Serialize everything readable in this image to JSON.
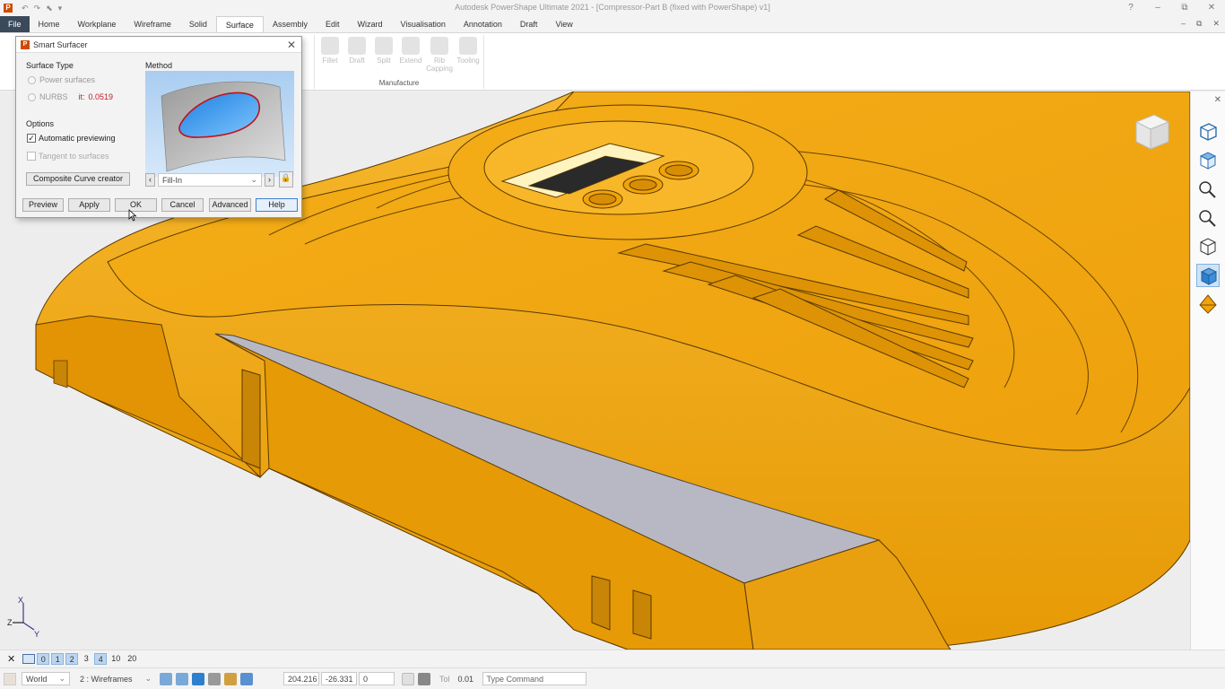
{
  "app": {
    "title": "Autodesk PowerShape Ultimate 2021 - [Compressor-Part B (fixed with PowerShape) v1]"
  },
  "window_controls": {
    "help": "?",
    "minimize": "–",
    "restore": "⧉",
    "close": "✕"
  },
  "tabs": [
    "File",
    "Home",
    "Workplane",
    "Wireframe",
    "Solid",
    "Surface",
    "Assembly",
    "Edit",
    "Wizard",
    "Visualisation",
    "Annotation",
    "Draft",
    "View"
  ],
  "active_tab": "Surface",
  "ribbon": {
    "manufacture_group": {
      "label": "Manufacture",
      "buttons": [
        "Fillet",
        "Draft",
        "Split",
        "Extend",
        "Rib Capping",
        "Tooling"
      ]
    }
  },
  "dialog": {
    "title": "Smart Surfacer",
    "surface_type": {
      "label": "Surface Type",
      "option_power": "Power surfaces",
      "option_nurbs": "NURBS",
      "tolerance_label": "it:",
      "tolerance_value": "0.0519"
    },
    "options": {
      "label": "Options",
      "automatic_previewing": "Automatic previewing",
      "automatic_previewing_checked": true,
      "tangent_to_surfaces": "Tangent to surfaces",
      "tangent_to_surfaces_checked": false
    },
    "composite_button": "Composite Curve creator",
    "method": {
      "label": "Method",
      "selected": "Fill-In"
    },
    "buttons": {
      "preview": "Preview",
      "apply": "Apply",
      "ok": "OK",
      "cancel": "Cancel",
      "advanced": "Advanced",
      "help": "Help"
    }
  },
  "levels": {
    "close": "✕",
    "items": [
      "0",
      "1",
      "2",
      "3",
      "4",
      "10",
      "20"
    ],
    "selected": [
      "0",
      "1",
      "2",
      "4"
    ]
  },
  "status": {
    "workplane": "World",
    "level_num": "2",
    "level_name": ": Wireframes",
    "x": "204.216",
    "y": "-26.331",
    "z": "0",
    "tol_label": "Tol",
    "tol_value": "0.01",
    "command_placeholder": "Type Command"
  },
  "triad": {
    "x": "X",
    "y": "Y",
    "z": "Z"
  },
  "colors": {
    "model": "#f0a30a",
    "model_dark": "#c98505",
    "cut_face": "#b8b8c4",
    "viewport_bg": "#ededed",
    "accent": "#3c7fd0"
  }
}
